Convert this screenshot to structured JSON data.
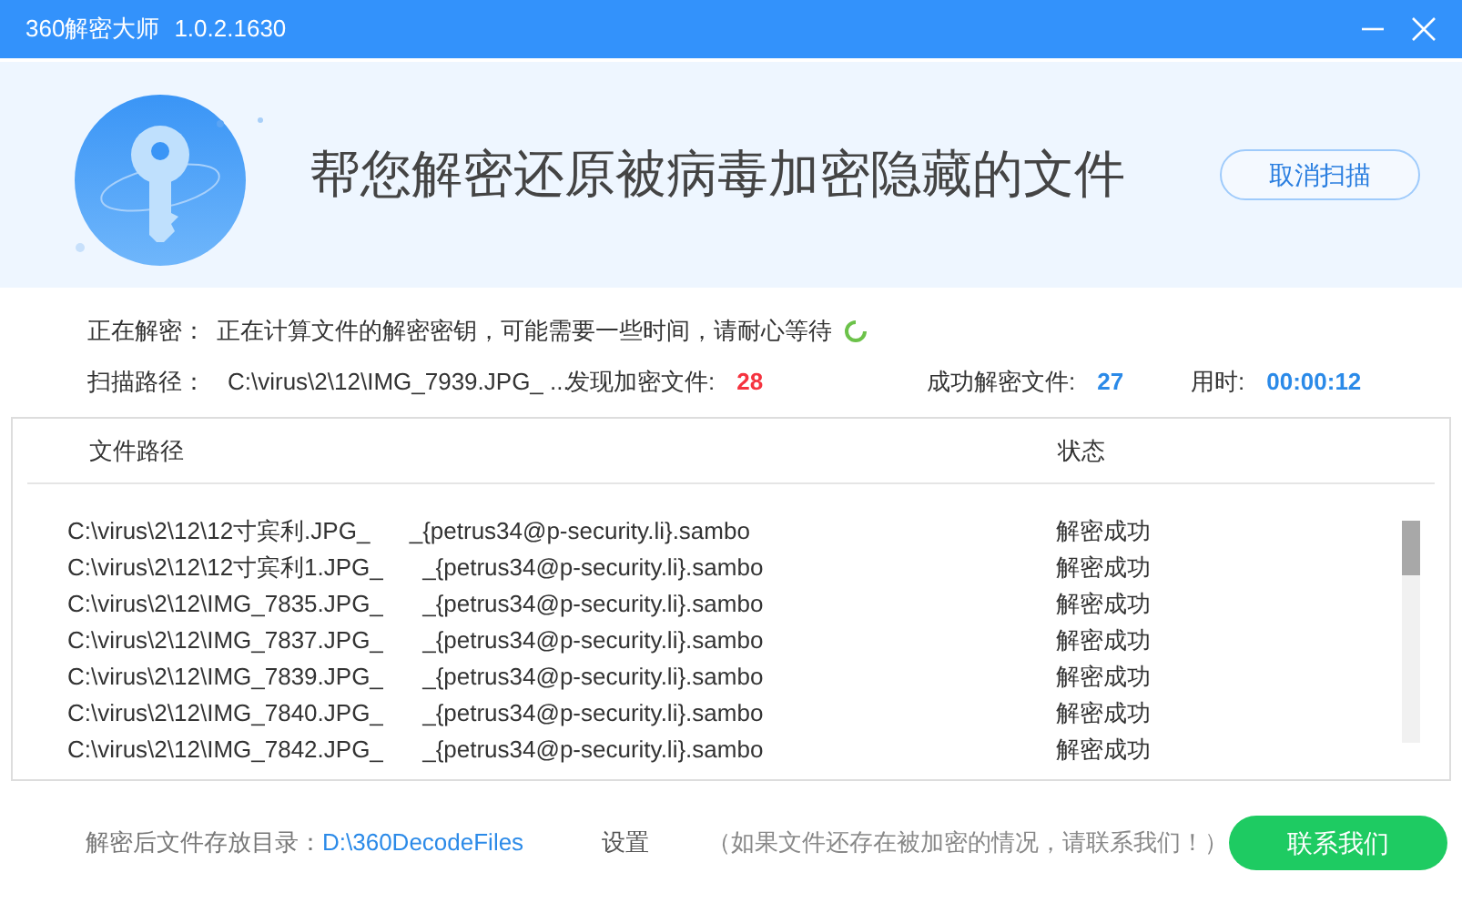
{
  "window": {
    "title": "360解密大师",
    "version": "1.0.2.1630"
  },
  "header": {
    "headline": "帮您解密还原被病毒加密隐藏的文件",
    "cancel_button": "取消扫描"
  },
  "status": {
    "label": "正在解密：",
    "message": "正在计算文件的解密密钥，可能需要一些时间，请耐心等待"
  },
  "stats": [
    {
      "label": "扫描路径：",
      "value": "C:\\virus\\2\\12\\IMG_7939.JPG_ ...",
      "kind": "path"
    },
    {
      "label": "发现加密文件:",
      "value": "28",
      "kind": "alert"
    },
    {
      "label": "成功解密文件:",
      "value": "27",
      "kind": "info"
    },
    {
      "label": "用时:",
      "value": "00:00:12",
      "kind": "info"
    }
  ],
  "table": {
    "columns": [
      "文件路径",
      "状态"
    ],
    "rows": [
      {
        "file": "C:\\virus\\2\\12\\12寸宾利.JPG_      _{petrus34@p-security.li}.sambo",
        "status": "解密成功"
      },
      {
        "file": "C:\\virus\\2\\12\\12寸宾利1.JPG_      _{petrus34@p-security.li}.sambo",
        "status": "解密成功"
      },
      {
        "file": "C:\\virus\\2\\12\\IMG_7835.JPG_      _{petrus34@p-security.li}.sambo",
        "status": "解密成功"
      },
      {
        "file": "C:\\virus\\2\\12\\IMG_7837.JPG_      _{petrus34@p-security.li}.sambo",
        "status": "解密成功"
      },
      {
        "file": "C:\\virus\\2\\12\\IMG_7839.JPG_      _{petrus34@p-security.li}.sambo",
        "status": "解密成功"
      },
      {
        "file": "C:\\virus\\2\\12\\IMG_7840.JPG_      _{petrus34@p-security.li}.sambo",
        "status": "解密成功"
      },
      {
        "file": "C:\\virus\\2\\12\\IMG_7842.JPG_      _{petrus34@p-security.li}.sambo",
        "status": "解密成功"
      }
    ]
  },
  "footer": {
    "dir_label": "解密后文件存放目录：",
    "dir_link": "D:\\360DecodeFiles",
    "settings": "设置",
    "note": "（如果文件还存在被加密的情况，请联系我们！）",
    "contact_button": "联系我们"
  }
}
